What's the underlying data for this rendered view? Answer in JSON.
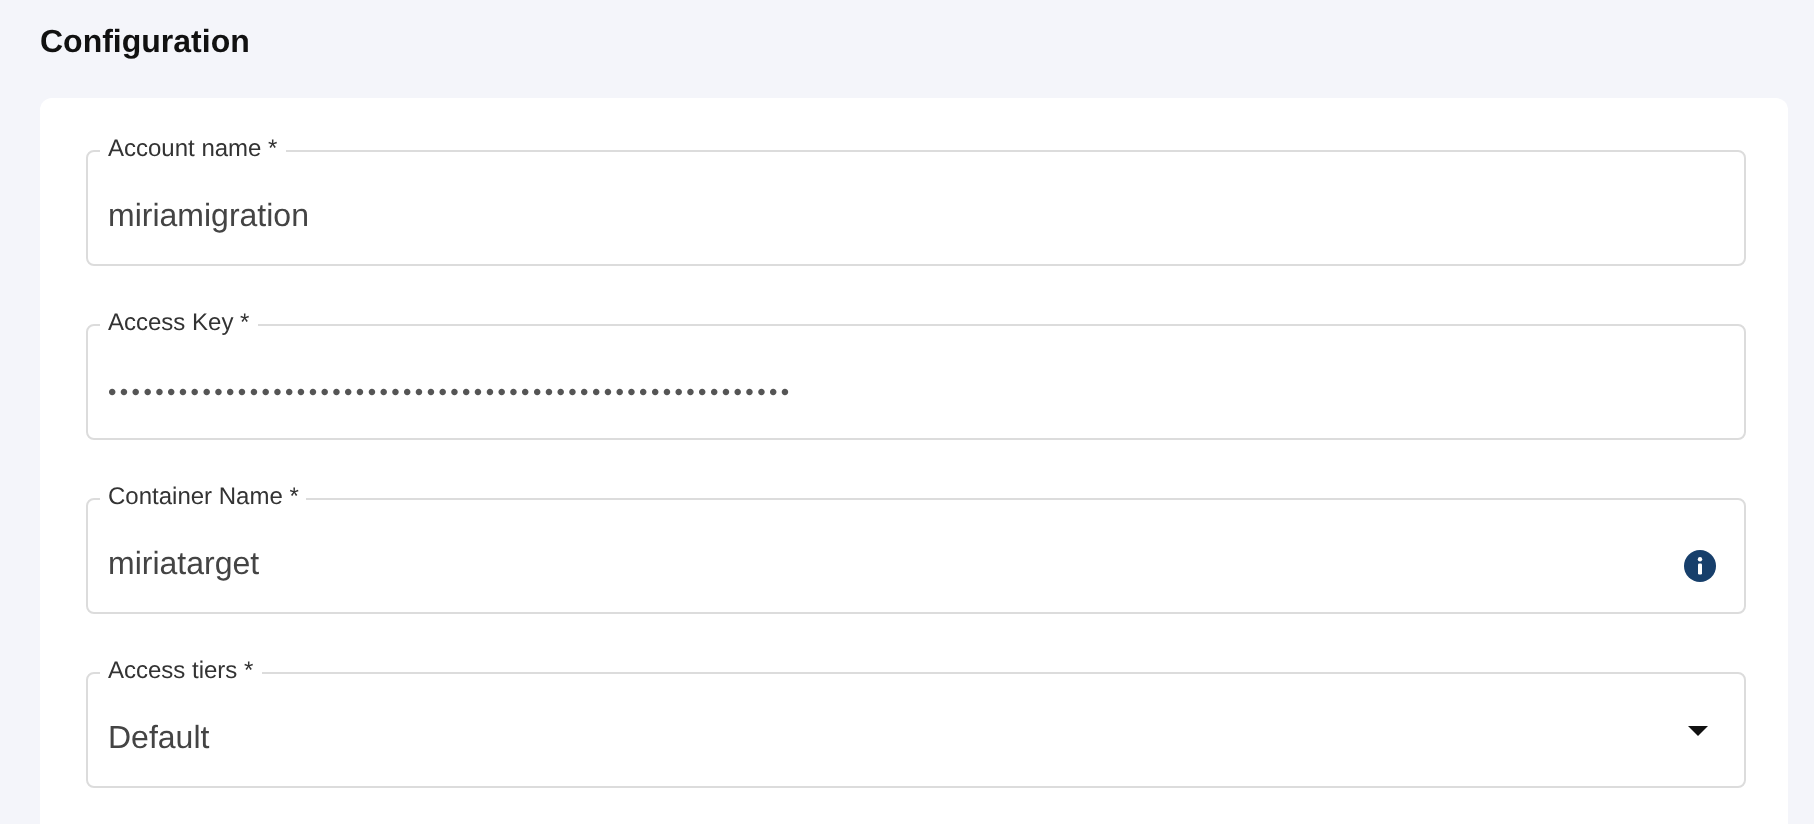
{
  "section": {
    "title": "Configuration"
  },
  "fields": [
    {
      "kind": "text",
      "label": "Account name *",
      "value": "miriamigration"
    },
    {
      "kind": "secret",
      "label": "Access Key *",
      "value": "••••••••••••••••••••••••••••••••••••••••••••••••••••••••••"
    },
    {
      "kind": "info",
      "label": "Container Name *",
      "value": "miriatarget"
    },
    {
      "kind": "select",
      "label": "Access tiers *",
      "value": "Default"
    }
  ]
}
